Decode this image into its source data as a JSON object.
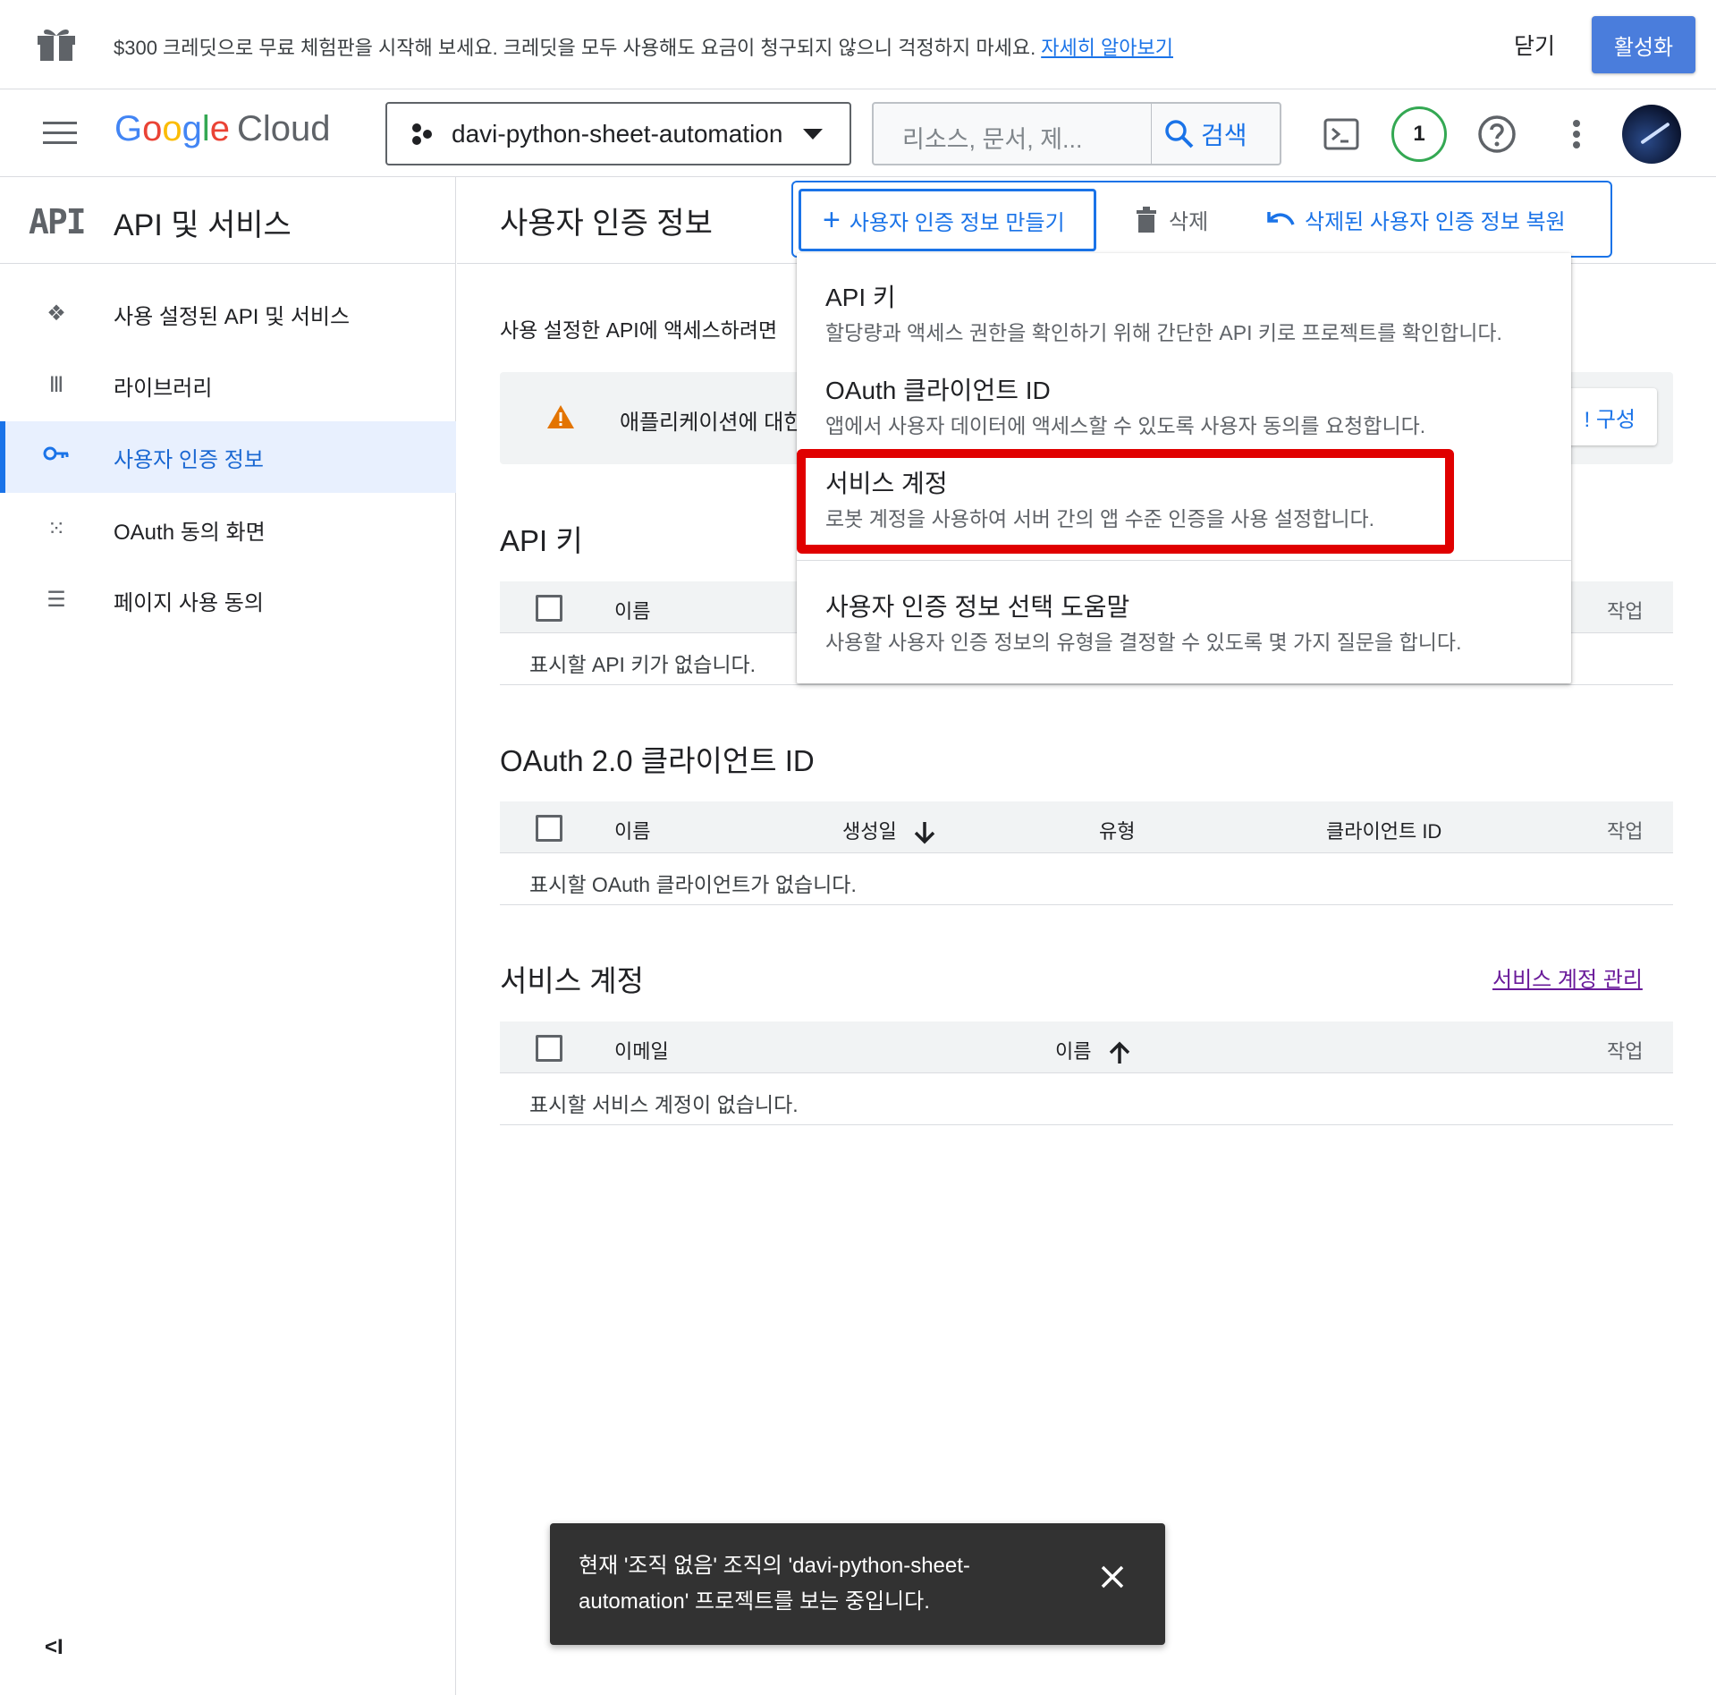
{
  "banner": {
    "message": "$300 크레딧으로 무료 체험판을 시작해 보세요. 크레딧을 모두 사용해도 요금이 청구되지 않으니 걱정하지 마세요.",
    "learn_more": "자세히 알아보기",
    "close": "닫기",
    "activate": "활성화"
  },
  "header": {
    "logo_brand": "Google",
    "logo_product": "Cloud",
    "project": "davi-python-sheet-automation",
    "search_placeholder": "리소스, 문서, 제...",
    "search_button": "검색",
    "notification_count": "1"
  },
  "sidebar": {
    "logo_text": "API",
    "title": "API 및 서비스",
    "items": [
      {
        "label": "사용 설정된 API 및 서비스",
        "icon": "diamond-grid-icon"
      },
      {
        "label": "라이브러리",
        "icon": "library-icon"
      },
      {
        "label": "사용자 인증 정보",
        "icon": "key-icon",
        "active": true
      },
      {
        "label": "OAuth 동의 화면",
        "icon": "dots-grid-icon"
      },
      {
        "label": "페이지 사용 동의",
        "icon": "settings-list-icon"
      }
    ],
    "collapse": "<I"
  },
  "main": {
    "title": "사용자 인증 정보",
    "create_button": "사용자 인증 정보 만들기",
    "delete_button": "삭제",
    "restore_button": "삭제된 사용자 인증 정보 복원",
    "intro": "사용 설정한 API에 액세스하려면",
    "warning_text": "애플리케이션에 대한",
    "configure_button": "! 구성",
    "api_keys": {
      "title": "API 키",
      "columns": [
        "이름",
        "작업"
      ],
      "empty": "표시할 API 키가 없습니다."
    },
    "oauth": {
      "title": "OAuth 2.0 클라이언트 ID",
      "columns": [
        "이름",
        "생성일",
        "유형",
        "클라이언트 ID",
        "작업"
      ],
      "empty": "표시할 OAuth 클라이언트가 없습니다."
    },
    "service_accounts": {
      "title": "서비스 계정",
      "manage_link": "서비스 계정 관리",
      "columns": [
        "이메일",
        "이름",
        "작업"
      ],
      "empty": "표시할 서비스 계정이 없습니다."
    }
  },
  "dropdown": {
    "items": [
      {
        "title": "API 키",
        "desc": "할당량과 액세스 권한을 확인하기 위해 간단한 API 키로 프로젝트를 확인합니다."
      },
      {
        "title": "OAuth 클라이언트 ID",
        "desc": "앱에서 사용자 데이터에 액세스할 수 있도록 사용자 동의를 요청합니다."
      },
      {
        "title": "서비스 계정",
        "desc": "로봇 계정을 사용하여 서버 간의 앱 수준 인증을 사용 설정합니다."
      },
      {
        "title": "사용자 인증 정보 선택 도움말",
        "desc": "사용할 사용자 인증 정보의 유형을 결정할 수 있도록 몇 가지 질문을 합니다."
      }
    ]
  },
  "toast": {
    "message": "현재 '조직 없음' 조직의 'davi-python-sheet-automation' 프로젝트를 보는 중입니다."
  },
  "colors": {
    "accent": "#1a73e8",
    "highlight": "#e00000",
    "success_ring": "#34a853"
  }
}
